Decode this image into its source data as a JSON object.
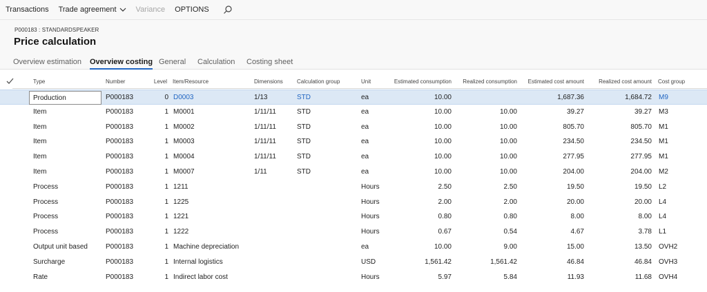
{
  "toolbar": {
    "transactions": "Transactions",
    "trade_agreement": "Trade agreement",
    "variance": "Variance",
    "options": "OPTIONS"
  },
  "header": {
    "breadcrumb": "P000183 : STANDARDSPEAKER",
    "title": "Price calculation"
  },
  "tabs": [
    {
      "label": "Overview estimation",
      "active": false
    },
    {
      "label": "Overview costing",
      "active": true
    },
    {
      "label": "General",
      "active": false
    },
    {
      "label": "Calculation",
      "active": false
    },
    {
      "label": "Costing sheet",
      "active": false
    }
  ],
  "columns": {
    "type": "Type",
    "number": "Number",
    "level": "Level",
    "item_resource": "Item/Resource",
    "dimensions": "Dimensions",
    "calc_group": "Calculation group",
    "unit": "Unit",
    "est_consumption": "Estimated consumption",
    "real_consumption": "Realized consumption",
    "est_cost": "Estimated cost amount",
    "real_cost": "Realized cost amount",
    "cost_group": "Cost group"
  },
  "rows": [
    {
      "type": "Production",
      "number": "P000183",
      "level": "0",
      "item": "D0003",
      "dimensions": "1/13",
      "calc_group": "STD",
      "unit": "ea",
      "est_consumption": "10.00",
      "real_consumption": "",
      "est_cost": "1,687.36",
      "real_cost": "1,684.72",
      "cost_group": "M9"
    },
    {
      "type": "Item",
      "number": "P000183",
      "level": "1",
      "item": "M0001",
      "dimensions": "1/11/11",
      "calc_group": "STD",
      "unit": "ea",
      "est_consumption": "10.00",
      "real_consumption": "10.00",
      "est_cost": "39.27",
      "real_cost": "39.27",
      "cost_group": "M3"
    },
    {
      "type": "Item",
      "number": "P000183",
      "level": "1",
      "item": "M0002",
      "dimensions": "1/11/11",
      "calc_group": "STD",
      "unit": "ea",
      "est_consumption": "10.00",
      "real_consumption": "10.00",
      "est_cost": "805.70",
      "real_cost": "805.70",
      "cost_group": "M1"
    },
    {
      "type": "Item",
      "number": "P000183",
      "level": "1",
      "item": "M0003",
      "dimensions": "1/11/11",
      "calc_group": "STD",
      "unit": "ea",
      "est_consumption": "10.00",
      "real_consumption": "10.00",
      "est_cost": "234.50",
      "real_cost": "234.50",
      "cost_group": "M1"
    },
    {
      "type": "Item",
      "number": "P000183",
      "level": "1",
      "item": "M0004",
      "dimensions": "1/11/11",
      "calc_group": "STD",
      "unit": "ea",
      "est_consumption": "10.00",
      "real_consumption": "10.00",
      "est_cost": "277.95",
      "real_cost": "277.95",
      "cost_group": "M1"
    },
    {
      "type": "Item",
      "number": "P000183",
      "level": "1",
      "item": "M0007",
      "dimensions": "1/11",
      "calc_group": "STD",
      "unit": "ea",
      "est_consumption": "10.00",
      "real_consumption": "10.00",
      "est_cost": "204.00",
      "real_cost": "204.00",
      "cost_group": "M2"
    },
    {
      "type": "Process",
      "number": "P000183",
      "level": "1",
      "item": "1211",
      "dimensions": "",
      "calc_group": "",
      "unit": "Hours",
      "est_consumption": "2.50",
      "real_consumption": "2.50",
      "est_cost": "19.50",
      "real_cost": "19.50",
      "cost_group": "L2"
    },
    {
      "type": "Process",
      "number": "P000183",
      "level": "1",
      "item": "1225",
      "dimensions": "",
      "calc_group": "",
      "unit": "Hours",
      "est_consumption": "2.00",
      "real_consumption": "2.00",
      "est_cost": "20.00",
      "real_cost": "20.00",
      "cost_group": "L4"
    },
    {
      "type": "Process",
      "number": "P000183",
      "level": "1",
      "item": "1221",
      "dimensions": "",
      "calc_group": "",
      "unit": "Hours",
      "est_consumption": "0.80",
      "real_consumption": "0.80",
      "est_cost": "8.00",
      "real_cost": "8.00",
      "cost_group": "L4"
    },
    {
      "type": "Process",
      "number": "P000183",
      "level": "1",
      "item": "1222",
      "dimensions": "",
      "calc_group": "",
      "unit": "Hours",
      "est_consumption": "0.67",
      "real_consumption": "0.54",
      "est_cost": "4.67",
      "real_cost": "3.78",
      "cost_group": "L1"
    },
    {
      "type": "Output unit based",
      "number": "P000183",
      "level": "1",
      "item": "Machine depreciation",
      "dimensions": "",
      "calc_group": "",
      "unit": "ea",
      "est_consumption": "10.00",
      "real_consumption": "9.00",
      "est_cost": "15.00",
      "real_cost": "13.50",
      "cost_group": "OVH2"
    },
    {
      "type": "Surcharge",
      "number": "P000183",
      "level": "1",
      "item": "Internal logistics",
      "dimensions": "",
      "calc_group": "",
      "unit": "USD",
      "est_consumption": "1,561.42",
      "real_consumption": "1,561.42",
      "est_cost": "46.84",
      "real_cost": "46.84",
      "cost_group": "OVH3"
    },
    {
      "type": "Rate",
      "number": "P000183",
      "level": "1",
      "item": "Indirect labor cost",
      "dimensions": "",
      "calc_group": "",
      "unit": "Hours",
      "est_consumption": "5.97",
      "real_consumption": "5.84",
      "est_cost": "11.93",
      "real_cost": "11.68",
      "cost_group": "OVH4"
    }
  ],
  "selected_row": 0,
  "colors": {
    "accent": "#2266c2",
    "selected_row": "#dce8f5"
  },
  "icons": {
    "search": "search-icon",
    "chevron": "chevron-down-icon",
    "select_all": "checkmark-icon"
  }
}
